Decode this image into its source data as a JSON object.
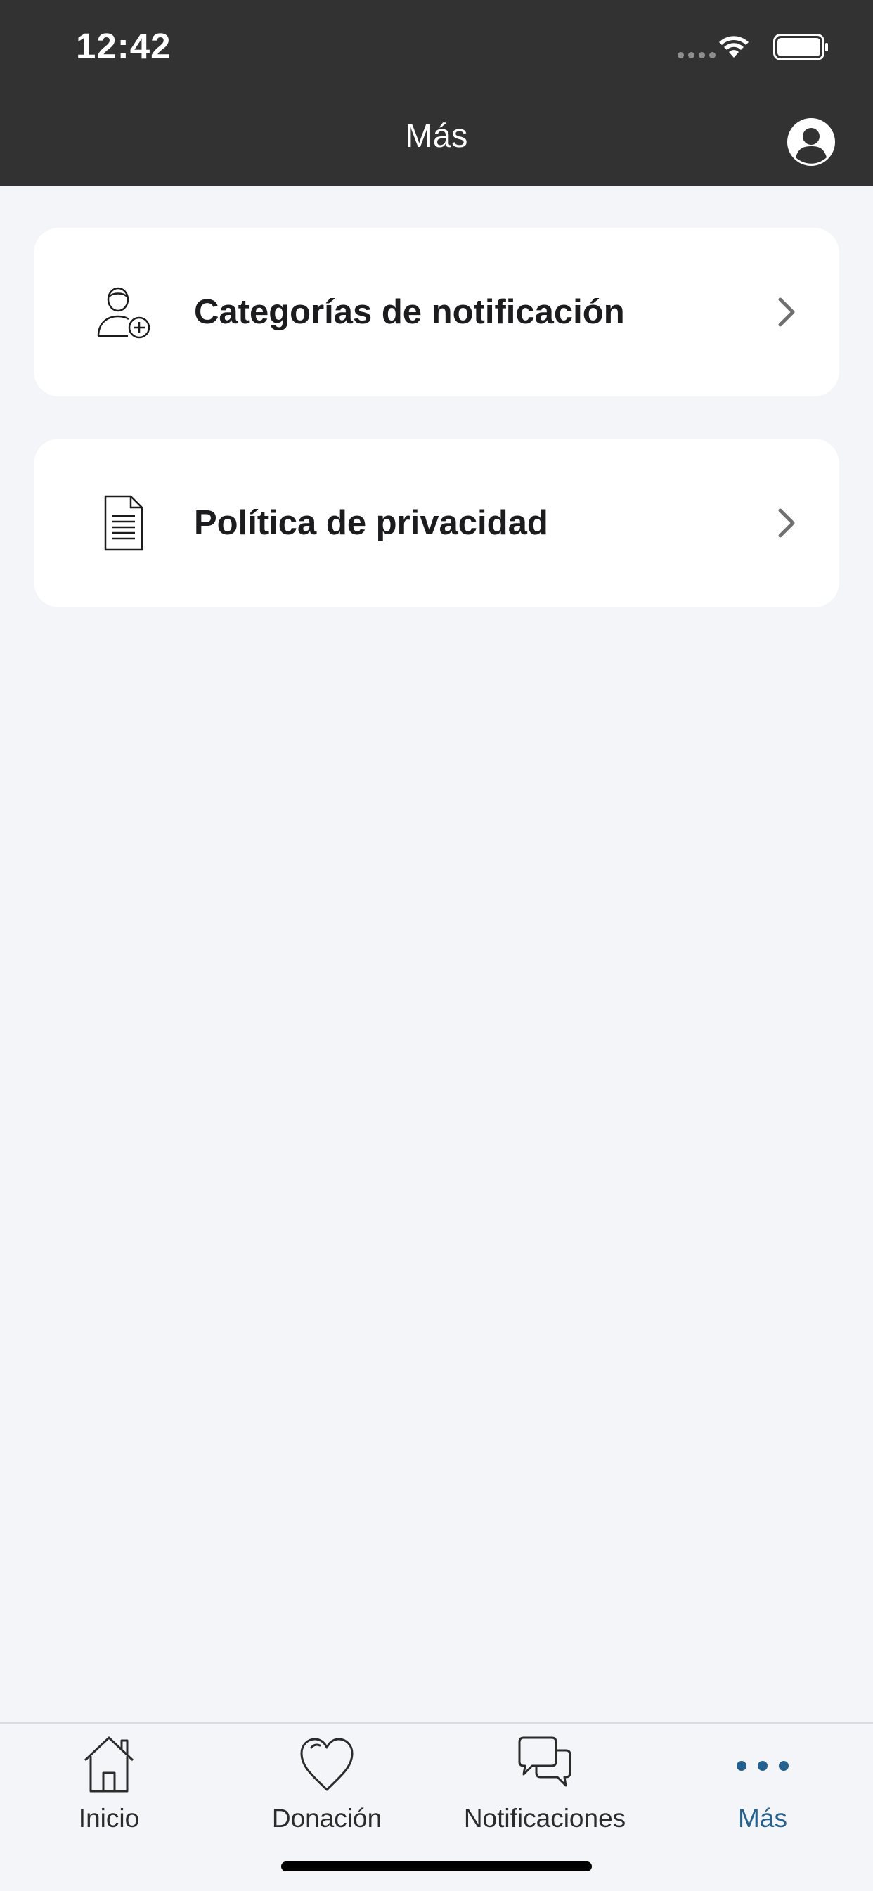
{
  "status_bar": {
    "time": "12:42"
  },
  "header": {
    "title": "Más"
  },
  "menu": [
    {
      "label": "Categorías de notificación",
      "icon": "user-add-icon"
    },
    {
      "label": "Política de privacidad",
      "icon": "document-icon"
    }
  ],
  "tabs": [
    {
      "label": "Inicio",
      "icon": "home-icon",
      "active": false
    },
    {
      "label": "Donación",
      "icon": "heart-icon",
      "active": false
    },
    {
      "label": "Notificaciones",
      "icon": "chat-bubbles-icon",
      "active": false
    },
    {
      "label": "Más",
      "icon": "more-dots-icon",
      "active": true
    }
  ],
  "colors": {
    "header_bg": "#323232",
    "background": "#f3f5f9",
    "accent": "#24618e"
  }
}
